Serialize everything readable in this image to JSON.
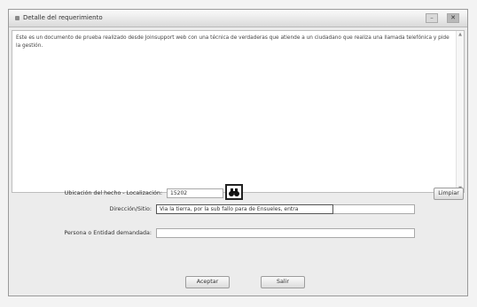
{
  "dialog": {
    "title": "Detalle del requerimiento",
    "minimize_glyph": "–",
    "close_glyph": "✕"
  },
  "editor": {
    "text": "Este es un documento de prueba realizado desde Joinsupport web con una técnica de verdaderas que atiende a un ciudadano que realiza una llamada telefónica y pide la gestión."
  },
  "form": {
    "location_label": "Ubicación del hecho - Localización:",
    "location_value": "15202",
    "address_label": "Dirección/Sitio:",
    "address_value": "Via la tierra, por la sub fallo para de Ensueles, entra",
    "contact_label": "Persona o Entidad demandada:",
    "contact_value": "",
    "clear_label": "Limpiar"
  },
  "buttons": {
    "accept": "Aceptar",
    "exit": "Salir"
  },
  "icons": {
    "locate": "binoculars-icon",
    "title": "window-icon"
  }
}
